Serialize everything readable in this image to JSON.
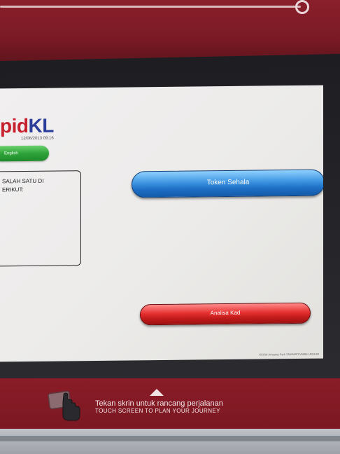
{
  "screen": {
    "logo": {
      "part_a": "pid",
      "part_b": "KL"
    },
    "datetime": "12/06/2013 09:16",
    "language_button": "English",
    "instruction_text": "SALAH SATU DI\nERIKUT:",
    "buttons": {
      "token": "Token Sehala",
      "card": "Analisa Kad"
    },
    "footer_note": "KIOSK Ampang Park T/M/AMPTVM/86 LR24-89"
  },
  "kiosk": {
    "tagline_ms": "Tekan skrin untuk rancang perjalanan",
    "tagline_en": "TOUCH SCREEN TO PLAN YOUR JOURNEY",
    "icons": {
      "touch": "hand-touch-icon",
      "arrow": "arrow-up-icon"
    }
  },
  "colors": {
    "brand_red": "#c7202f",
    "brand_blue": "#2b3f9a",
    "button_blue": "#1d6fc6",
    "button_red": "#c31b1b",
    "button_green": "#2ea33a",
    "housing": "#7a1a25"
  }
}
